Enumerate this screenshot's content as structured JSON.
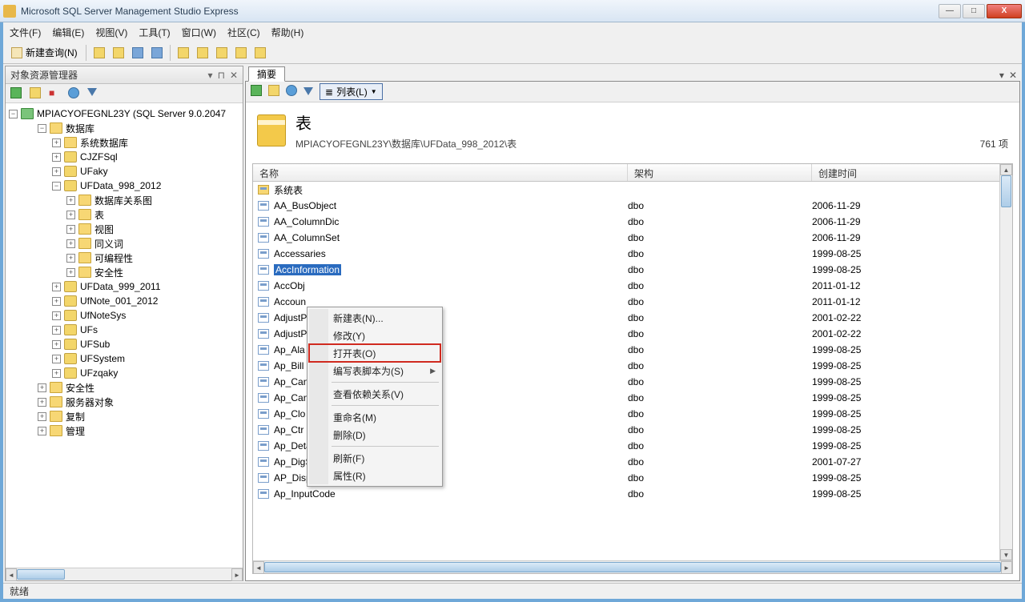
{
  "window": {
    "title": "Microsoft SQL Server Management Studio Express"
  },
  "menubar": [
    "文件(F)",
    "编辑(E)",
    "视图(V)",
    "工具(T)",
    "窗口(W)",
    "社区(C)",
    "帮助(H)"
  ],
  "toolbar": {
    "new_query": "新建查询(N)"
  },
  "left_panel": {
    "title": "对象资源管理器",
    "server": "MPIACYOFEGNL23Y (SQL Server 9.0.2047",
    "tree": [
      {
        "level": 1,
        "exp": "-",
        "icon": "folder",
        "label": "数据库"
      },
      {
        "level": 2,
        "exp": "+",
        "icon": "folder",
        "label": "系统数据库"
      },
      {
        "level": 2,
        "exp": "+",
        "icon": "db",
        "label": "CJZFSql"
      },
      {
        "level": 2,
        "exp": "+",
        "icon": "db",
        "label": "UFaky"
      },
      {
        "level": 2,
        "exp": "-",
        "icon": "db",
        "label": "UFData_998_2012"
      },
      {
        "level": 3,
        "exp": "+",
        "icon": "folder",
        "label": "数据库关系图"
      },
      {
        "level": 3,
        "exp": "+",
        "icon": "folder",
        "label": "表"
      },
      {
        "level": 3,
        "exp": "+",
        "icon": "folder",
        "label": "视图"
      },
      {
        "level": 3,
        "exp": "+",
        "icon": "folder",
        "label": "同义词"
      },
      {
        "level": 3,
        "exp": "+",
        "icon": "folder",
        "label": "可编程性"
      },
      {
        "level": 3,
        "exp": "+",
        "icon": "folder",
        "label": "安全性"
      },
      {
        "level": 2,
        "exp": "+",
        "icon": "db",
        "label": "UFData_999_2011"
      },
      {
        "level": 2,
        "exp": "+",
        "icon": "db",
        "label": "UfNote_001_2012"
      },
      {
        "level": 2,
        "exp": "+",
        "icon": "db",
        "label": "UfNoteSys"
      },
      {
        "level": 2,
        "exp": "+",
        "icon": "db",
        "label": "UFs"
      },
      {
        "level": 2,
        "exp": "+",
        "icon": "db",
        "label": "UFSub"
      },
      {
        "level": 2,
        "exp": "+",
        "icon": "db",
        "label": "UFSystem"
      },
      {
        "level": 2,
        "exp": "+",
        "icon": "db",
        "label": "UFzqaky"
      },
      {
        "level": 1,
        "exp": "+",
        "icon": "folder",
        "label": "安全性"
      },
      {
        "level": 1,
        "exp": "+",
        "icon": "folder",
        "label": "服务器对象"
      },
      {
        "level": 1,
        "exp": "+",
        "icon": "folder",
        "label": "复制"
      },
      {
        "level": 1,
        "exp": "+",
        "icon": "folder",
        "label": "管理"
      }
    ]
  },
  "right_panel": {
    "tab": "摘要",
    "list_button": "列表(L)",
    "heading": "表",
    "path": "MPIACYOFEGNL23Y\\数据库\\UFData_998_2012\\表",
    "count": "761 项",
    "columns": [
      "名称",
      "架构",
      "创建时间"
    ],
    "rows": [
      {
        "name": "系统表",
        "schema": "",
        "created": "",
        "folder": true
      },
      {
        "name": "AA_BusObject",
        "schema": "dbo",
        "created": "2006-11-29"
      },
      {
        "name": "AA_ColumnDic",
        "schema": "dbo",
        "created": "2006-11-29"
      },
      {
        "name": "AA_ColumnSet",
        "schema": "dbo",
        "created": "2006-11-29"
      },
      {
        "name": "Accessaries",
        "schema": "dbo",
        "created": "1999-08-25"
      },
      {
        "name": "AccInformation",
        "schema": "dbo",
        "created": "1999-08-25",
        "selected": true
      },
      {
        "name": "AccObj",
        "schema": "dbo",
        "created": "2011-01-12"
      },
      {
        "name": "Accoun",
        "schema": "dbo",
        "created": "2011-01-12"
      },
      {
        "name": "AdjustP",
        "schema": "dbo",
        "created": "2001-02-22"
      },
      {
        "name": "AdjustP",
        "schema": "dbo",
        "created": "2001-02-22"
      },
      {
        "name": "Ap_Ala",
        "schema": "dbo",
        "created": "1999-08-25"
      },
      {
        "name": "Ap_Bill",
        "schema": "dbo",
        "created": "1999-08-25"
      },
      {
        "name": "Ap_Can",
        "schema": "dbo",
        "created": "1999-08-25"
      },
      {
        "name": "Ap_Can",
        "schema": "dbo",
        "created": "1999-08-25"
      },
      {
        "name": "Ap_Clo",
        "schema": "dbo",
        "created": "1999-08-25"
      },
      {
        "name": "Ap_Ctr",
        "schema": "dbo",
        "created": "1999-08-25"
      },
      {
        "name": "Ap_Detail",
        "schema": "dbo",
        "created": "1999-08-25"
      },
      {
        "name": "Ap_DigSet",
        "schema": "dbo",
        "created": "2001-07-27"
      },
      {
        "name": "AP_DispSet",
        "schema": "dbo",
        "created": "1999-08-25"
      },
      {
        "name": "Ap_InputCode",
        "schema": "dbo",
        "created": "1999-08-25"
      }
    ]
  },
  "context_menu": {
    "items": [
      {
        "label": "新建表(N)..."
      },
      {
        "label": "修改(Y)"
      },
      {
        "label": "打开表(O)",
        "highlight": true
      },
      {
        "label": "编写表脚本为(S)",
        "submenu": true
      },
      {
        "sep": true
      },
      {
        "label": "查看依赖关系(V)"
      },
      {
        "sep": true
      },
      {
        "label": "重命名(M)"
      },
      {
        "label": "删除(D)"
      },
      {
        "sep": true
      },
      {
        "label": "刷新(F)"
      },
      {
        "label": "属性(R)"
      }
    ]
  },
  "statusbar": {
    "text": "就绪"
  }
}
